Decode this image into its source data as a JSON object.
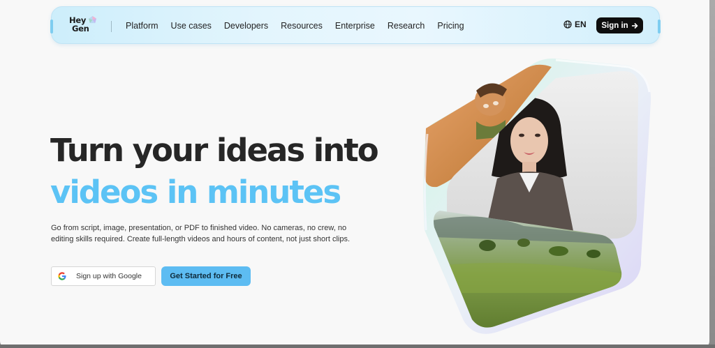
{
  "nav": {
    "logo_line1": "Hey",
    "logo_line2": "Gen",
    "links": [
      "Platform",
      "Use cases",
      "Developers",
      "Resources",
      "Enterprise",
      "Research",
      "Pricing"
    ],
    "language": "EN",
    "signin_label": "Sign in"
  },
  "hero": {
    "headline_line1": "Turn your ideas into",
    "headline_line2": "videos in minutes",
    "subtitle": "Go from script, image, presentation, or PDF to finished video. No cameras, no crew, no editing skills required. Create full-length videos and hours of content, not just short clips.",
    "google_label": "Sign up with Google",
    "start_label": "Get Started for Free"
  },
  "colors": {
    "accent": "#5cc3f5",
    "headline": "#262626",
    "button_primary": "#5dbcf2",
    "nav_bg": "#e3f5fd"
  },
  "icons": {
    "globe": "globe-icon",
    "arrow": "arrow-right-icon",
    "google": "google-icon",
    "logo_mark": "heygen-gem-icon"
  }
}
